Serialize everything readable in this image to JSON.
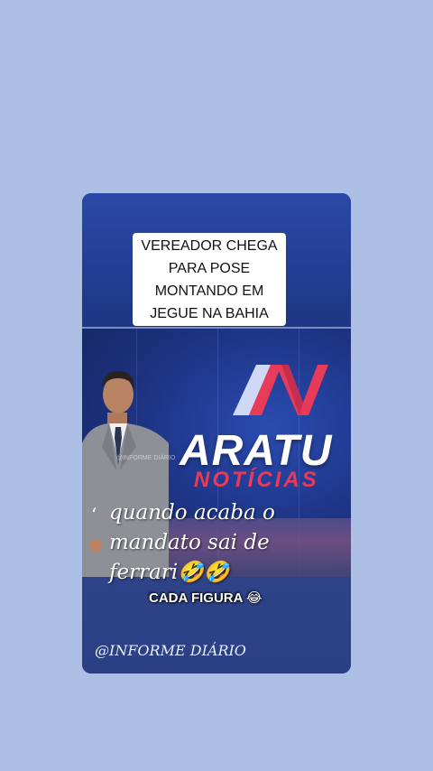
{
  "post": {
    "headline": "VEREADOR CHEGA\nPARA POSE\nMONTANDO EM\nJEGUE NA BAHIA",
    "channel_logo": "AV",
    "brand_name": "ARATU",
    "brand_sub": "NOTÍCIAS",
    "small_watermark": "@INFORME DIÁRIO",
    "caption_mark": "‘",
    "caption": "quando acaba o\nmandato sai de\nferrari🤣🤣",
    "sub_caption": "CADA FIGURA 😂",
    "handle": "@INFORME DIÁRIO"
  },
  "colors": {
    "background": "#adbfe5",
    "studio_blue": "#1c317e",
    "brand_red": "#e83b5a",
    "white": "#ffffff"
  }
}
